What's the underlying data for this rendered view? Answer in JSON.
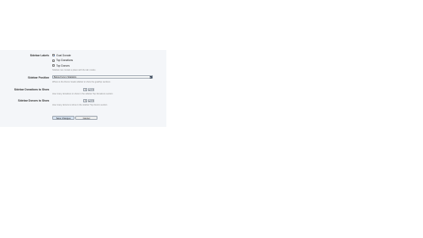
{
  "rows": {
    "sidebar_labels": "Sidebar Labels",
    "sidebar_position": "Sidebar Position",
    "donations_to_show": "Sidebar Donations to Show",
    "donors_to_show": "Sidebar Donors to Show"
  },
  "checkboxes": [
    {
      "label": "Goal Donate",
      "checked": true
    },
    {
      "label": "Top Donations",
      "checked": false
    },
    {
      "label": "Top Donors",
      "checked": false
    }
  ],
  "help": {
    "labels": "Sidebar can contain a place with the tab modes",
    "position": "Where is the Donor Goals sidebar to show the goal/top sections",
    "donations": "How many donations to show in the sidebar Top Donations section",
    "donors": "How many donors to show in the sidebar Top donors section"
  },
  "select": {
    "value": "Below Forum Statistics"
  },
  "steppers": {
    "donations_value": "5",
    "donors_value": "5",
    "up": "▲",
    "down": "▼"
  },
  "buttons": {
    "save": "Save Changes",
    "cancel": "Cancel"
  },
  "colors": {
    "panel_bg": "#f4f6f9",
    "select_button": "#3c4a5c",
    "save_bg": "#d7e3f1"
  }
}
